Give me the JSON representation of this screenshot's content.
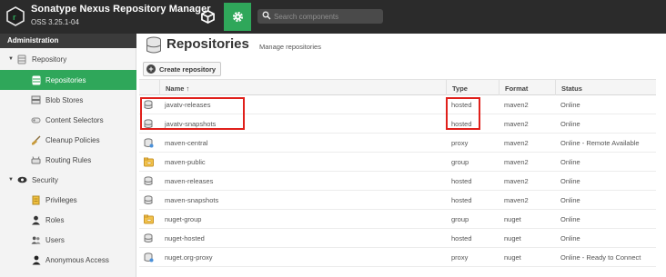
{
  "app": {
    "title": "Sonatype Nexus Repository Manager",
    "version": "OSS 3.25.1-04",
    "search_placeholder": "Search components"
  },
  "sidebar": {
    "header": "Administration",
    "items": [
      {
        "label": "Repository",
        "icon": "database-icon",
        "type": "group"
      },
      {
        "label": "Repositories",
        "icon": "database-icon",
        "type": "child",
        "selected": true
      },
      {
        "label": "Blob Stores",
        "icon": "server-icon",
        "type": "child"
      },
      {
        "label": "Content Selectors",
        "icon": "layers-icon",
        "type": "child"
      },
      {
        "label": "Cleanup Policies",
        "icon": "broom-icon",
        "type": "child"
      },
      {
        "label": "Routing Rules",
        "icon": "router-icon",
        "type": "child"
      },
      {
        "label": "Security",
        "icon": "eye-icon",
        "type": "group"
      },
      {
        "label": "Privileges",
        "icon": "medal-icon",
        "type": "child"
      },
      {
        "label": "Roles",
        "icon": "user-roles-icon",
        "type": "child"
      },
      {
        "label": "Users",
        "icon": "users-icon",
        "type": "child"
      },
      {
        "label": "Anonymous Access",
        "icon": "user-icon",
        "type": "child"
      }
    ]
  },
  "page": {
    "title": "Repositories",
    "subtitle": "Manage repositories",
    "create_button": "Create repository"
  },
  "table": {
    "columns": [
      "Name ↑",
      "Type",
      "Format",
      "Status"
    ],
    "rows": [
      {
        "name": "javatv-releases",
        "type": "hosted",
        "format": "maven2",
        "status": "Online",
        "icon": "hosted-icon"
      },
      {
        "name": "javatv-snapshots",
        "type": "hosted",
        "format": "maven2",
        "status": "Online",
        "icon": "hosted-icon"
      },
      {
        "name": "maven-central",
        "type": "proxy",
        "format": "maven2",
        "status": "Online - Remote Available",
        "icon": "proxy-icon"
      },
      {
        "name": "maven-public",
        "type": "group",
        "format": "maven2",
        "status": "Online",
        "icon": "group-icon"
      },
      {
        "name": "maven-releases",
        "type": "hosted",
        "format": "maven2",
        "status": "Online",
        "icon": "hosted-icon"
      },
      {
        "name": "maven-snapshots",
        "type": "hosted",
        "format": "maven2",
        "status": "Online",
        "icon": "hosted-icon"
      },
      {
        "name": "nuget-group",
        "type": "group",
        "format": "nuget",
        "status": "Online",
        "icon": "group-icon"
      },
      {
        "name": "nuget-hosted",
        "type": "hosted",
        "format": "nuget",
        "status": "Online",
        "icon": "hosted-icon"
      },
      {
        "name": "nuget.org-proxy",
        "type": "proxy",
        "format": "nuget",
        "status": "Online - Ready to Connect",
        "icon": "proxy-icon"
      }
    ]
  },
  "colors": {
    "accent": "#2fa75a",
    "topbar": "#2b2b2b",
    "highlight": "#e0201b"
  }
}
